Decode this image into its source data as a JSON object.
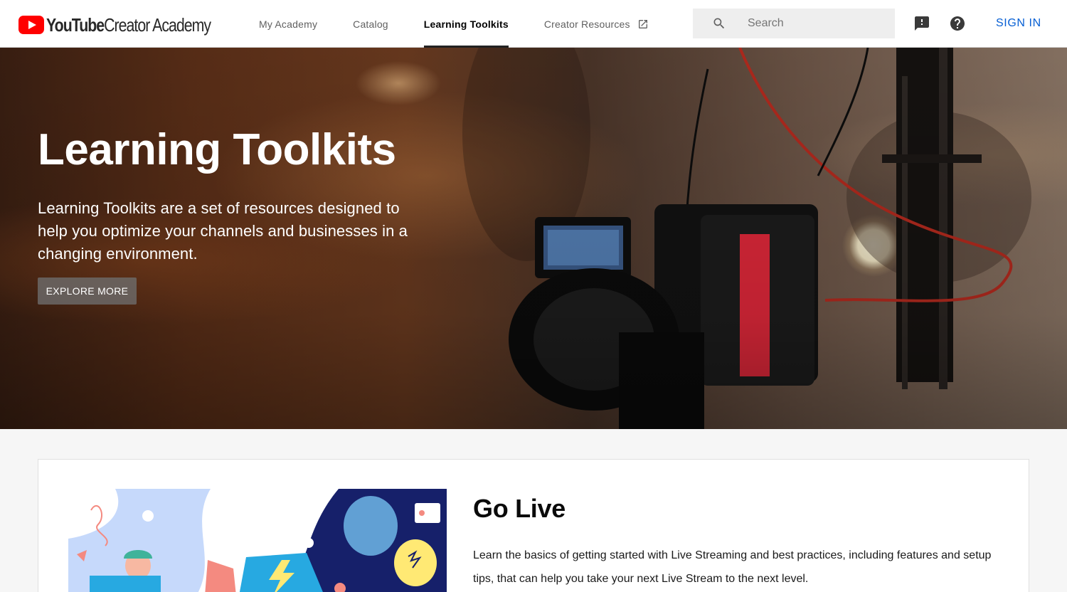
{
  "header": {
    "logo": {
      "brand": "YouTube",
      "suffix": "Creator Academy"
    },
    "nav": [
      {
        "label": "My Academy",
        "active": false
      },
      {
        "label": "Catalog",
        "active": false
      },
      {
        "label": "Learning Toolkits",
        "active": true
      },
      {
        "label": "Creator Resources",
        "active": false,
        "external": true
      }
    ],
    "search": {
      "placeholder": "Search"
    },
    "icons": {
      "feedback": "feedback-icon",
      "help": "help-icon",
      "search": "search-icon",
      "external": "external-link-icon"
    },
    "signin_label": "SIGN IN"
  },
  "hero": {
    "title": "Learning Toolkits",
    "description": "Learning Toolkits are a set of resources designed to help you optimize your channels and businesses in a changing environment.",
    "button_label": "EXPLORE MORE"
  },
  "card": {
    "title": "Go Live",
    "description": "Learn the basics of getting started with Live Streaming and best practices, including features and setup tips, that can help you take your next Live Stream to the next level."
  },
  "colors": {
    "brand_red": "#ff0000",
    "link_blue": "#065fd4",
    "illus_blue": "#c6d9fb",
    "illus_navy": "#16206a",
    "illus_cyan": "#27a9e1",
    "illus_coral": "#f48a80",
    "illus_yellow": "#ffe974"
  }
}
